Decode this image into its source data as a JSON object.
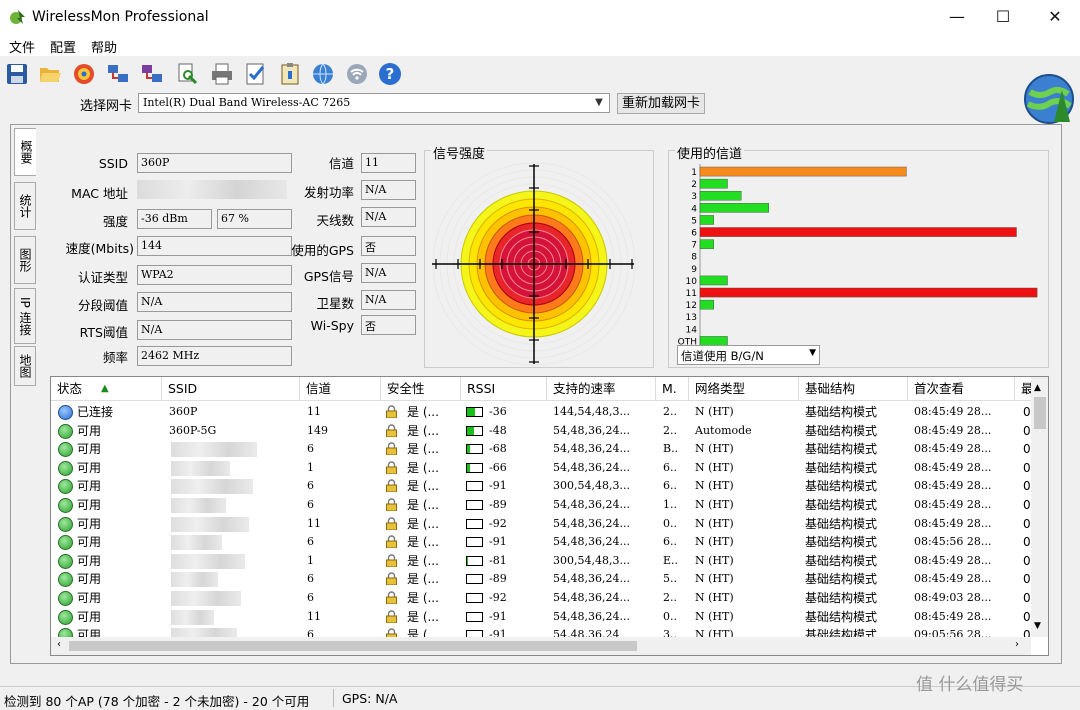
{
  "window": {
    "title": "WirelessMon Professional",
    "min": "—",
    "max": "☐",
    "close": "✕"
  },
  "menu": [
    "文件",
    "配置",
    "帮助"
  ],
  "toolbar_icons": [
    "save-icon",
    "folder-open-icon",
    "target-icon",
    "network-icon",
    "network-export-icon",
    "print-preview-icon",
    "print-icon",
    "checklist-icon",
    "clipboard-icon",
    "globe-network-icon",
    "wifi-icon",
    "help-icon"
  ],
  "adapter": {
    "label": "选择网卡",
    "value": "Intel(R) Dual Band Wireless-AC 7265",
    "reload": "重新加载网卡"
  },
  "tabs": [
    "概要",
    "统计",
    "图形",
    "IP 连接",
    "地图"
  ],
  "summary": {
    "ssid_label": "SSID",
    "ssid": "360P",
    "mac_label": "MAC 地址",
    "strength_label": "强度",
    "strength_dbm": "-36 dBm",
    "strength_pct": "67 %",
    "speed_label": "速度(Mbits)",
    "speed": "144",
    "auth_label": "认证类型",
    "auth": "WPA2",
    "frag_label": "分段阈值",
    "frag": "N/A",
    "rts_label": "RTS阈值",
    "rts": "N/A",
    "freq_label": "频率",
    "freq": "2462 MHz",
    "channel_label": "信道",
    "channel": "11",
    "txpower_label": "发射功率",
    "txpower": "N/A",
    "antenna_label": "天线数",
    "antenna": "N/A",
    "gps_used_label": "使用的GPS",
    "gps_used": "否",
    "gps_signal_label": "GPS信号",
    "gps_signal": "N/A",
    "satellites_label": "卫星数",
    "satellites": "N/A",
    "wispy_label": "Wi-Spy",
    "wispy": "否"
  },
  "signal_panel": {
    "title": "信号强度"
  },
  "channels_panel": {
    "title": "使用的信道",
    "select": "信道使用 B/G/N",
    "chart_data": {
      "type": "bar",
      "categories": [
        "1",
        "2",
        "3",
        "4",
        "5",
        "6",
        "7",
        "8",
        "9",
        "10",
        "11",
        "12",
        "13",
        "14",
        "OTH"
      ],
      "values": [
        30,
        4,
        6,
        10,
        2,
        46,
        2,
        0,
        0,
        4,
        49,
        2,
        0,
        0,
        4
      ],
      "colors": [
        "#f58a1f",
        "#22dd22",
        "#22dd22",
        "#22dd22",
        "#22dd22",
        "#ee1111",
        "#22dd22",
        "#22dd22",
        "#22dd22",
        "#22dd22",
        "#ee1111",
        "#22dd22",
        "#22dd22",
        "#22dd22",
        "#22dd22"
      ],
      "xlim": [
        0,
        50
      ]
    }
  },
  "grid": {
    "columns": [
      "状态",
      "SSID",
      "信道",
      "安全性",
      "RSSI",
      "支持的速率",
      "M.",
      "网络类型",
      "基础结构",
      "首次查看",
      "最"
    ],
    "rows": [
      {
        "status": "已连接",
        "connected": true,
        "ssid": "360P",
        "channel": "11",
        "secure": "是 (...",
        "rssi": "-36",
        "rssi_level": 0.55,
        "rates": "144,54,48,3...",
        "m": "2..",
        "nettype": "N (HT)",
        "infra": "基础结构模式",
        "first": "08:45:49 28...",
        "last": "0"
      },
      {
        "status": "可用",
        "connected": false,
        "ssid": "360P-5G",
        "channel": "149",
        "secure": "是 (...",
        "rssi": "-48",
        "rssi_level": 0.45,
        "rates": "54,48,36,24...",
        "m": "2..",
        "nettype": "Automode",
        "infra": "基础结构模式",
        "first": "08:45:49 28...",
        "last": "0"
      },
      {
        "status": "可用",
        "connected": false,
        "ssid": "",
        "channel": "6",
        "secure": "是 (...",
        "rssi": "-68",
        "rssi_level": 0.2,
        "rates": "54,48,36,24...",
        "m": "B..",
        "nettype": "N (HT)",
        "infra": "基础结构模式",
        "first": "08:45:49 28...",
        "last": "0"
      },
      {
        "status": "可用",
        "connected": false,
        "ssid": "",
        "channel": "1",
        "secure": "是 (...",
        "rssi": "-66",
        "rssi_level": 0.2,
        "rates": "54,48,36,24...",
        "m": "6..",
        "nettype": "N (HT)",
        "infra": "基础结构模式",
        "first": "08:45:49 28...",
        "last": "0"
      },
      {
        "status": "可用",
        "connected": false,
        "ssid": "",
        "channel": "6",
        "secure": "是 (...",
        "rssi": "-91",
        "rssi_level": 0,
        "rates": "300,54,48,3...",
        "m": "6..",
        "nettype": "N (HT)",
        "infra": "基础结构模式",
        "first": "08:45:49 28...",
        "last": "0"
      },
      {
        "status": "可用",
        "connected": false,
        "ssid": "",
        "channel": "6",
        "secure": "是 (...",
        "rssi": "-89",
        "rssi_level": 0,
        "rates": "54,48,36,24...",
        "m": "1..",
        "nettype": "N (HT)",
        "infra": "基础结构模式",
        "first": "08:45:49 28...",
        "last": "0"
      },
      {
        "status": "可用",
        "connected": false,
        "ssid": "",
        "channel": "11",
        "secure": "是 (...",
        "rssi": "-92",
        "rssi_level": 0,
        "rates": "54,48,36,24...",
        "m": "0..",
        "nettype": "N (HT)",
        "infra": "基础结构模式",
        "first": "08:45:49 28...",
        "last": "0"
      },
      {
        "status": "可用",
        "connected": false,
        "ssid": "",
        "channel": "6",
        "secure": "是 (...",
        "rssi": "-91",
        "rssi_level": 0,
        "rates": "54,48,36,24...",
        "m": "6..",
        "nettype": "N (HT)",
        "infra": "基础结构模式",
        "first": "08:45:56 28...",
        "last": "0"
      },
      {
        "status": "可用",
        "connected": false,
        "ssid": "",
        "channel": "1",
        "secure": "是 (...",
        "rssi": "-81",
        "rssi_level": 0.08,
        "rates": "300,54,48,3...",
        "m": "E..",
        "nettype": "N (HT)",
        "infra": "基础结构模式",
        "first": "08:45:49 28...",
        "last": "0"
      },
      {
        "status": "可用",
        "connected": false,
        "ssid": "",
        "channel": "6",
        "secure": "是 (...",
        "rssi": "-89",
        "rssi_level": 0,
        "rates": "54,48,36,24...",
        "m": "5..",
        "nettype": "N (HT)",
        "infra": "基础结构模式",
        "first": "08:45:49 28...",
        "last": "0"
      },
      {
        "status": "可用",
        "connected": false,
        "ssid": "",
        "channel": "6",
        "secure": "是 (...",
        "rssi": "-92",
        "rssi_level": 0,
        "rates": "54,48,36,24...",
        "m": "2..",
        "nettype": "N (HT)",
        "infra": "基础结构模式",
        "first": "08:49:03 28...",
        "last": "0"
      },
      {
        "status": "可用",
        "connected": false,
        "ssid": "",
        "channel": "11",
        "secure": "是 (...",
        "rssi": "-91",
        "rssi_level": 0,
        "rates": "54,48,36,24...",
        "m": "0..",
        "nettype": "N (HT)",
        "infra": "基础结构模式",
        "first": "08:45:49 28...",
        "last": "0"
      },
      {
        "status": "可用",
        "connected": false,
        "ssid": "",
        "channel": "6",
        "secure": "是 (...",
        "rssi": "-91",
        "rssi_level": 0,
        "rates": "54,48,36,24",
        "m": "3..",
        "nettype": "N (HT)",
        "infra": "基础结构模式",
        "first": "09:05:56 28...",
        "last": "0"
      }
    ]
  },
  "statusbar": {
    "left": "检测到 80 个AP (78 个加密 - 2 个未加密) - 20 个可用",
    "gps": "GPS: N/A"
  },
  "watermark": "值 什么值得买"
}
